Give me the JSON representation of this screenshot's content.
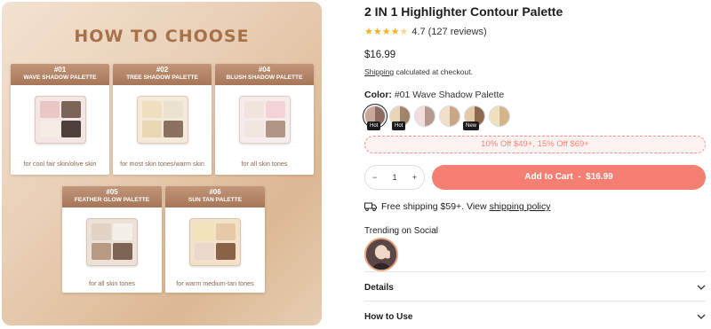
{
  "promo_image": {
    "heading": "HOW TO CHOOSE",
    "cards": [
      {
        "num": "#01",
        "name": "WAVE SHADOW PALETTE",
        "caption": "for cool fair skin/olive skin"
      },
      {
        "num": "#02",
        "name": "TREE SHADOW PALETTE",
        "caption": "for most skin tones/warm skin"
      },
      {
        "num": "#04",
        "name": "BLUSH SHADOW PALETTE",
        "caption": "for all skin tones"
      },
      {
        "num": "#05",
        "name": "FEATHER GLOW PALETTE",
        "caption": "for all skin tones"
      },
      {
        "num": "#06",
        "name": "SUN TAN PALETTE",
        "caption": "for warm medium-tan tones"
      }
    ]
  },
  "product": {
    "title": "2 IN 1 Highlighter Contour Palette",
    "rating": 4.7,
    "rating_text": "4.7",
    "reviews": "(127 reviews)",
    "price": "$16.99",
    "shipping_link": "Shipping",
    "shipping_text": "calculated at checkout.",
    "color_label": "Color:",
    "color_value": "#01 Wave Shadow Palette",
    "swatches": [
      {
        "badge": "Hot",
        "c1": "#c9a89a",
        "c2": "#8a6c60",
        "selected": true
      },
      {
        "badge": "Hot",
        "c1": "#e7d4b7",
        "c2": "#a0836b",
        "selected": false
      },
      {
        "badge": "",
        "c1": "#f2dede",
        "c2": "#b49a8c",
        "selected": false
      },
      {
        "badge": "",
        "c1": "#f1dfc8",
        "c2": "#c8a688",
        "selected": false
      },
      {
        "badge": "New",
        "c1": "#e3c9a8",
        "c2": "#8d6a4f",
        "selected": false
      },
      {
        "badge": "",
        "c1": "#efe0c0",
        "c2": "#d3b58b",
        "selected": false
      }
    ],
    "promo_bar": "10% Off $49+, 15% Off $69+",
    "quantity": "1",
    "qty_minus": "−",
    "qty_plus": "+",
    "add_to_cart": "Add to Cart  -  $16.99",
    "free_shipping": "Free shipping $59+. View",
    "shipping_policy": "shipping policy",
    "trending_label": "Trending on Social",
    "accordions": [
      {
        "label": "Details"
      },
      {
        "label": "How to Use"
      }
    ]
  },
  "colors": {
    "accent": "#f47f72",
    "stars": "#f0b429",
    "promo_heading": "#a9714a"
  }
}
